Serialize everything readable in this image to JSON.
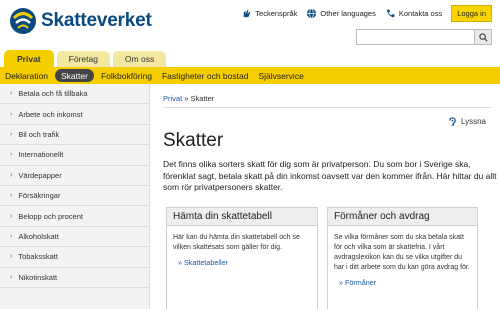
{
  "header": {
    "logo_text": "Skatteverket",
    "links": [
      {
        "label": "Teckenspråk",
        "icon": "sign-language-icon"
      },
      {
        "label": "Other languages",
        "icon": "globe-icon"
      },
      {
        "label": "Kontakta oss",
        "icon": "phone-icon"
      }
    ],
    "login_label": "Logga in",
    "search_value": ""
  },
  "tabs": [
    {
      "label": "Privat",
      "active": true
    },
    {
      "label": "Företag",
      "active": false
    },
    {
      "label": "Om oss",
      "active": false
    }
  ],
  "subnav": [
    {
      "label": "Deklaration",
      "active": false
    },
    {
      "label": "Skatter",
      "active": true
    },
    {
      "label": "Folkbokföring",
      "active": false
    },
    {
      "label": "Fastigheter och bostad",
      "active": false
    },
    {
      "label": "Självservice",
      "active": false
    }
  ],
  "sidebar": {
    "items": [
      {
        "label": "Betala och få tillbaka"
      },
      {
        "label": "Arbete och inkomst"
      },
      {
        "label": "Bil och trafik"
      },
      {
        "label": "Internationellt"
      },
      {
        "label": "Värdepapper"
      },
      {
        "label": "Försäkringar"
      },
      {
        "label": "Belopp och procent"
      },
      {
        "label": "Alkoholskatt"
      },
      {
        "label": "Tobaksskatt"
      },
      {
        "label": "Nikotinskatt"
      }
    ]
  },
  "main": {
    "breadcrumb": {
      "home": "Privat",
      "separator": " » ",
      "current": "Skatter"
    },
    "listen_label": "Lyssna",
    "title": "Skatter",
    "intro": "Det finns olika sorters skatt för dig som är privatperson. Du som bor i Sverige ska, förenklat sagt, betala skatt på din inkomst oavsett var den kommer ifrån. Här hittar du allt som rör privatpersoners skatter.",
    "cards": [
      {
        "heading": "Hämta din skattetabell",
        "body": "Här kan du hämta din skattetabell och se vilken skattesats som gäller för dig.",
        "link": "» Skattetabeller"
      },
      {
        "heading": "Förmåner och avdrag",
        "body": "Se vilka förmåner som du ska betala skatt för och vilka som är skattefria. I vårt avdragslexikon kan du se vilka utgifter du har i ditt arbete som du kan göra avdrag för.",
        "link": "» Förmåner"
      }
    ]
  },
  "colors": {
    "brand_blue": "#0a4a80",
    "accent_yellow": "#f5ce00",
    "link_blue": "#1a5aa0"
  }
}
